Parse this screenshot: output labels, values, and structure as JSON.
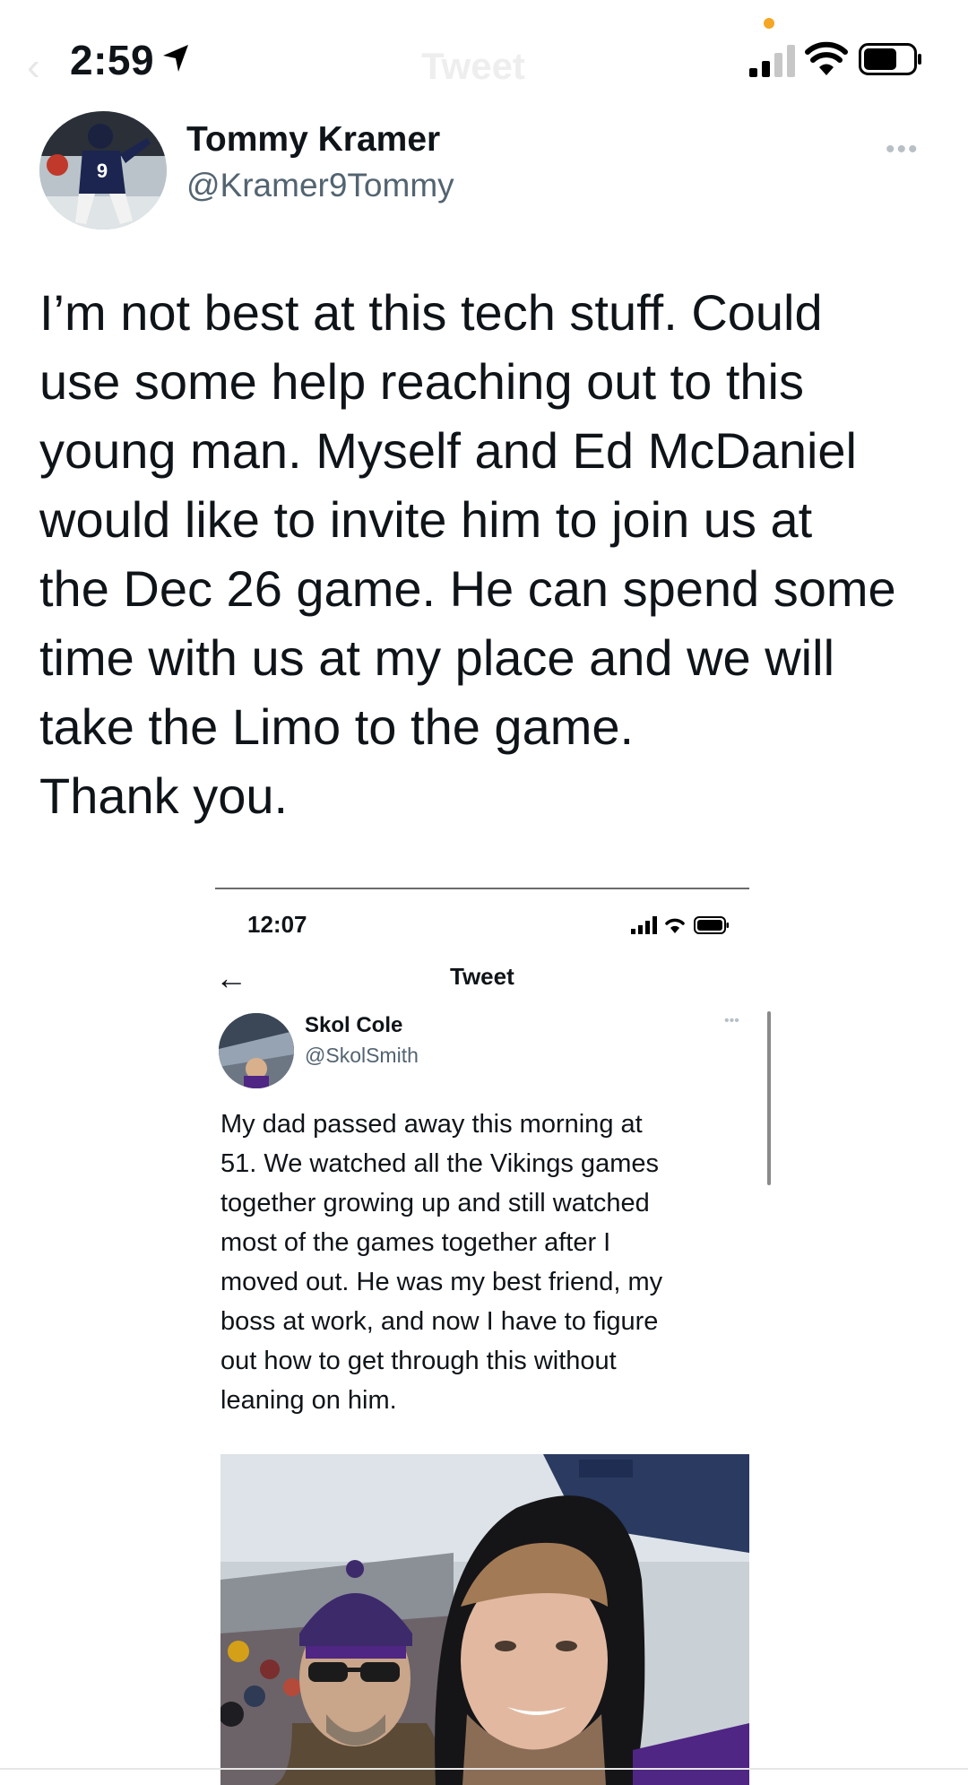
{
  "status_bar": {
    "time": "2:59",
    "icons": [
      "location-arrow-icon",
      "cellular-signal-icon",
      "wifi-icon",
      "battery-icon"
    ],
    "indicator_color": "#f5a623",
    "ghost_header_title": "Tweet"
  },
  "tweet": {
    "author": {
      "display_name": "Tommy Kramer",
      "handle": "@Kramer9Tommy"
    },
    "text": "I’m not best at this tech stuff. Could\nuse some help reaching out to this\nyoung man. Myself and Ed McDaniel\nwould like to invite him to join us at\nthe Dec 26 game. He can spend some\ntime with us at my place and we will\ntake the Limo to the game.\nThank you."
  },
  "embedded_screenshot": {
    "status_time": "12:07",
    "header_title": "Tweet",
    "author": {
      "display_name": "Skol Cole",
      "handle": "@SkolSmith"
    },
    "text": "My dad passed away this morning at\n51. We watched all the Vikings games\ntogether growing up and still watched\nmost of the games together after I\nmoved out. He was my best friend, my\nboss at work, and now I have to figure\nout how to get through this without\nleaning on him.",
    "photo_description": "selfie-two-men-stadium"
  },
  "colors": {
    "text_primary": "#0f1419",
    "text_secondary": "#536471",
    "vikings_purple": "#4f2683"
  }
}
